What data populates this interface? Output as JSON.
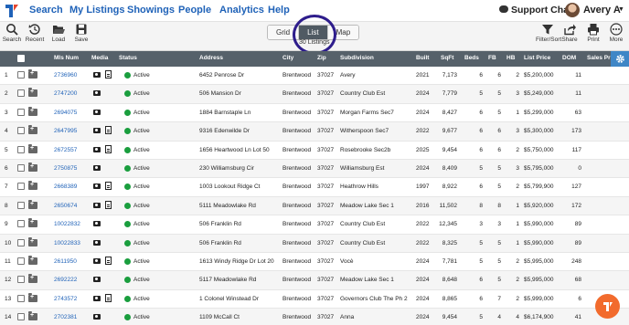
{
  "nav": {
    "links": [
      "Search",
      "My Listings",
      "Showings",
      "People",
      "Analytics",
      "Help"
    ],
    "support": "Support Chat",
    "user": "Avery A"
  },
  "toolbar": {
    "search": "Search",
    "recent": "Recent",
    "load": "Load",
    "save": "Save",
    "views": [
      "Grid",
      "List",
      "Map"
    ],
    "active_view": "List",
    "count": "30 Listings",
    "filter_sort": "Filter/Sort",
    "share": "Share",
    "print": "Print",
    "more": "More"
  },
  "table": {
    "headers": [
      "Mls Num",
      "Media",
      "Status",
      "Address",
      "City",
      "Zip",
      "Subdivision",
      "Built",
      "SqFt",
      "Beds",
      "FB",
      "HB",
      "List Price",
      "DOM",
      "Sales Pr"
    ],
    "rows": [
      {
        "n": "1",
        "mls": "2736960",
        "doc": true,
        "status": "Active",
        "address": "6452 Penrose Dr",
        "city": "Brentwood",
        "zip": "37027",
        "sub": "Avery",
        "built": "2021",
        "sqft": "7,173",
        "beds": "6",
        "fb": "6",
        "hb": "2",
        "price": "$5,200,000",
        "dom": "11"
      },
      {
        "n": "2",
        "mls": "2747200",
        "doc": false,
        "status": "Active",
        "address": "506 Mansion Dr",
        "city": "Brentwood",
        "zip": "37027",
        "sub": "Country Club Est",
        "built": "2024",
        "sqft": "7,779",
        "beds": "5",
        "fb": "5",
        "hb": "3",
        "price": "$5,249,000",
        "dom": "11"
      },
      {
        "n": "3",
        "mls": "2694075",
        "doc": false,
        "status": "Active",
        "address": "1884 Barnstaple Ln",
        "city": "Brentwood",
        "zip": "37027",
        "sub": "Morgan Farms Sec7",
        "built": "2024",
        "sqft": "8,427",
        "beds": "6",
        "fb": "5",
        "hb": "1",
        "price": "$5,299,000",
        "dom": "63"
      },
      {
        "n": "4",
        "mls": "2647995",
        "doc": true,
        "status": "Active",
        "address": "9316 Edenwilde Dr",
        "city": "Brentwood",
        "zip": "37027",
        "sub": "Witherspoon Sec7",
        "built": "2022",
        "sqft": "9,677",
        "beds": "6",
        "fb": "6",
        "hb": "3",
        "price": "$5,300,000",
        "dom": "173"
      },
      {
        "n": "5",
        "mls": "2672557",
        "doc": true,
        "status": "Active",
        "address": "1656 Heartwood Ln Lot 50",
        "city": "Brentwood",
        "zip": "37027",
        "sub": "Rosebrooke Sec2b",
        "built": "2025",
        "sqft": "9,454",
        "beds": "6",
        "fb": "6",
        "hb": "2",
        "price": "$5,750,000",
        "dom": "117"
      },
      {
        "n": "6",
        "mls": "2750875",
        "doc": false,
        "status": "Active",
        "address": "230 Williamsburg Cir",
        "city": "Brentwood",
        "zip": "37027",
        "sub": "Williamsburg Est",
        "built": "2024",
        "sqft": "8,409",
        "beds": "5",
        "fb": "5",
        "hb": "3",
        "price": "$5,795,000",
        "dom": "0"
      },
      {
        "n": "7",
        "mls": "2668389",
        "doc": true,
        "status": "Active",
        "address": "1003 Lookout Ridge Ct",
        "city": "Brentwood",
        "zip": "37027",
        "sub": "Heathrow Hills",
        "built": "1997",
        "sqft": "8,922",
        "beds": "6",
        "fb": "5",
        "hb": "2",
        "price": "$5,799,900",
        "dom": "127"
      },
      {
        "n": "8",
        "mls": "2650674",
        "doc": true,
        "status": "Active",
        "address": "5111 Meadowlake Rd",
        "city": "Brentwood",
        "zip": "37027",
        "sub": "Meadow Lake Sec 1",
        "built": "2016",
        "sqft": "11,502",
        "beds": "8",
        "fb": "8",
        "hb": "1",
        "price": "$5,920,000",
        "dom": "172"
      },
      {
        "n": "9",
        "mls": "10022832",
        "doc": false,
        "status": "Active",
        "address": "506 Franklin Rd",
        "city": "Brentwood",
        "zip": "37027",
        "sub": "Country Club Est",
        "built": "2022",
        "sqft": "12,345",
        "beds": "3",
        "fb": "3",
        "hb": "1",
        "price": "$5,990,000",
        "dom": "89"
      },
      {
        "n": "10",
        "mls": "10022833",
        "doc": false,
        "status": "Active",
        "address": "506 Franklin Rd",
        "city": "Brentwood",
        "zip": "37027",
        "sub": "Country Club Est",
        "built": "2022",
        "sqft": "8,325",
        "beds": "5",
        "fb": "5",
        "hb": "1",
        "price": "$5,990,000",
        "dom": "89"
      },
      {
        "n": "11",
        "mls": "2611950",
        "doc": true,
        "status": "Active",
        "address": "1613 Windy Ridge Dr Lot 20",
        "city": "Brentwood",
        "zip": "37027",
        "sub": "Vocè",
        "built": "2024",
        "sqft": "7,781",
        "beds": "5",
        "fb": "5",
        "hb": "2",
        "price": "$5,995,000",
        "dom": "248"
      },
      {
        "n": "12",
        "mls": "2692222",
        "doc": false,
        "status": "Active",
        "address": "5117 Meadowlake Rd",
        "city": "Brentwood",
        "zip": "37027",
        "sub": "Meadow Lake Sec 1",
        "built": "2024",
        "sqft": "8,648",
        "beds": "6",
        "fb": "5",
        "hb": "2",
        "price": "$5,995,000",
        "dom": "68"
      },
      {
        "n": "13",
        "mls": "2743572",
        "doc": true,
        "status": "Active",
        "address": "1 Colonel Winstead Dr",
        "city": "Brentwood",
        "zip": "37027",
        "sub": "Governors Club The Ph 2",
        "built": "2024",
        "sqft": "8,865",
        "beds": "6",
        "fb": "7",
        "hb": "2",
        "price": "$5,999,000",
        "dom": "6"
      },
      {
        "n": "14",
        "mls": "2702381",
        "doc": false,
        "status": "Active",
        "address": "1109 McCall Ct",
        "city": "Brentwood",
        "zip": "37027",
        "sub": "Anna",
        "built": "2024",
        "sqft": "9,454",
        "beds": "5",
        "fb": "4",
        "hb": "4",
        "price": "$6,174,900",
        "dom": "41"
      }
    ]
  },
  "colors": {
    "link": "#1f62b8",
    "header_bg": "#56616a",
    "active_dot": "#1a9e3e",
    "help_button": "#f26b2d",
    "ring": "#2e1d8c"
  }
}
